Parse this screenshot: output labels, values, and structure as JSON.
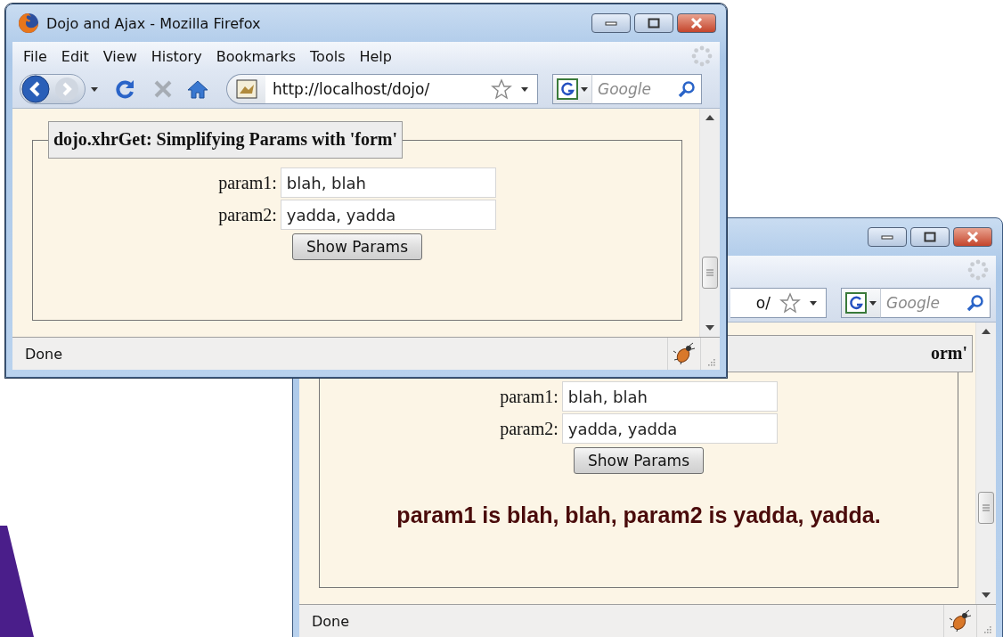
{
  "windows": [
    {
      "title": "Dojo and Ajax - Mozilla Firefox",
      "menu": [
        "File",
        "Edit",
        "View",
        "History",
        "Bookmarks",
        "Tools",
        "Help"
      ],
      "url": "http://localhost/dojo/",
      "search_placeholder": "Google",
      "legend": "dojo.xhrGet: Simplifying Params with 'form'",
      "fields": [
        {
          "label": "param1:",
          "value": "blah, blah"
        },
        {
          "label": "param2:",
          "value": "yadda, yadda"
        }
      ],
      "button": "Show Params",
      "status": "Done"
    },
    {
      "url": "o/",
      "search_placeholder": "Google",
      "legend": "orm'",
      "fields": [
        {
          "label": "param1:",
          "value": "blah, blah"
        },
        {
          "label": "param2:",
          "value": "yadda, yadda"
        }
      ],
      "button": "Show Params",
      "result": "param1 is blah, blah, param2 is yadda, yadda.",
      "status": "Done"
    }
  ]
}
